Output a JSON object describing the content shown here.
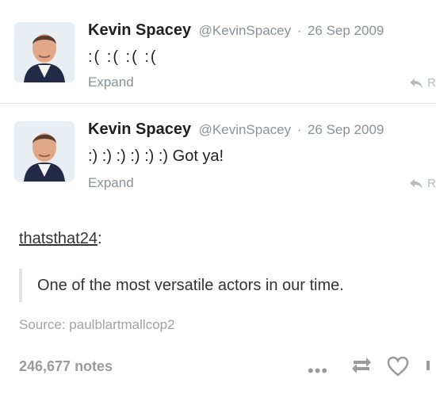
{
  "tweets": [
    {
      "name": "Kevin Spacey",
      "handle": "@KevinSpacey",
      "separator": "·",
      "date": "26 Sep 2009",
      "text": ":(  :(  :(  :(",
      "expand": "Expand",
      "reply": "R"
    },
    {
      "name": "Kevin Spacey",
      "handle": "@KevinSpacey",
      "separator": "·",
      "date": "26 Sep 2009",
      "text": ":)  :)  :)  :)  :)  :)  Got ya!",
      "expand": "Expand",
      "reply": "R"
    }
  ],
  "post": {
    "author": "thatsthat24",
    "colon": ":",
    "quote": "One of the most versatile actors in our time.",
    "source": "Source: paulblartmallcop2",
    "notes": "246,677 notes",
    "more_glyph": "•••"
  },
  "colors": {
    "muted": "#8a9196",
    "divider": "#e3e6e8",
    "quote_bar": "#e2e2e2"
  },
  "icons": [
    "avatar",
    "reply-icon",
    "more-icon",
    "reblog-icon",
    "heart-icon"
  ]
}
